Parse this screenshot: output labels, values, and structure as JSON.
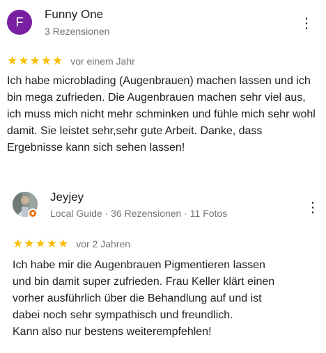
{
  "reviews": [
    {
      "avatar_letter": "F",
      "avatar_color": "#7b1fa2",
      "author": "Funny One",
      "meta": "3 Rezensionen",
      "stars": "★★★★★",
      "rating": 5,
      "date": "vor einem Jahr",
      "text": "Ich habe microblading (Augenbrauen) machen lassen und ich bin mega zufrieden. Die Augenbrauen machen sehr viel aus, ich muss mich nicht mehr schminken und fühle mich sehr wohl damit. Sie leistet sehr,sehr gute Arbeit. Danke, dass Ergebnisse kann sich sehen lassen!",
      "more_icon": "more-vert-icon"
    },
    {
      "avatar_type": "photo",
      "badge_icon": "local-guide-badge-icon",
      "author": "Jeyjey",
      "meta": "Local Guide · 36 Rezensionen · 11 Fotos",
      "stars": "★★★★★",
      "rating": 5,
      "date": "vor 2 Jahren",
      "text_lines": [
        "Ich habe mir die Augenbrauen Pigmentieren lassen",
        "und bin damit super zufrieden. Frau Keller klärt einen",
        "vorher ausführlich über die Behandlung auf und ist",
        "dabei noch sehr sympathisch und freundlich.",
        "Kann also nur bestens weiterempfehlen!"
      ],
      "more_icon": "more-vert-icon"
    }
  ]
}
